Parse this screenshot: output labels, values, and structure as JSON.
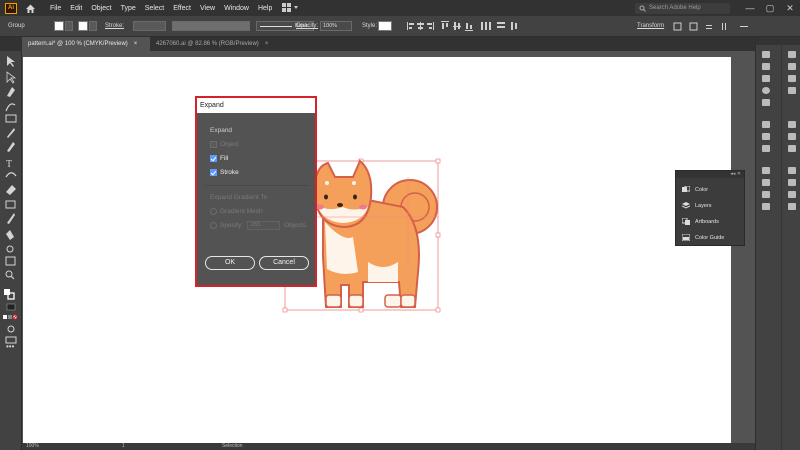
{
  "app": {
    "logo": "Ai"
  },
  "menu": [
    "File",
    "Edit",
    "Object",
    "Type",
    "Select",
    "Effect",
    "View",
    "Window",
    "Help"
  ],
  "search": {
    "placeholder": "Search Adobe Help"
  },
  "window_controls": {
    "minimize": "—",
    "maximize": "▢",
    "close": "✕"
  },
  "control_bar": {
    "selection_label": "Group",
    "stroke_label": "Stroke:",
    "brush_label": "Basic",
    "opacity_label": "Opacity:",
    "opacity_value": "100%",
    "style_label": "Style:",
    "transform_label": "Transform"
  },
  "tabs": [
    {
      "label": "pattern.ai* @ 100 % (CMYK/Preview)",
      "close": "×"
    },
    {
      "label": "4267060.ai @ 82.86 % (RGB/Preview)",
      "close": "×"
    }
  ],
  "float_panel": {
    "items": [
      {
        "label": "Color",
        "icon": "color-icon"
      },
      {
        "label": "Layers",
        "icon": "layers-icon"
      },
      {
        "label": "Artboards",
        "icon": "artboards-icon"
      },
      {
        "label": "Color Guide",
        "icon": "color-guide-icon"
      }
    ]
  },
  "dialog": {
    "title": "Expand",
    "expand_section": "Expand",
    "object_label": "Object",
    "fill_label": "Fill",
    "stroke_label": "Stroke",
    "gradient_section": "Expand Gradient To",
    "gradient_mesh_label": "Gradient Mesh",
    "specify_label": "Specify:",
    "specify_value": "255",
    "objects_label": "Objects",
    "ok": "OK",
    "cancel": "Cancel",
    "object_checked": false,
    "fill_checked": true,
    "stroke_checked": true
  },
  "status": {
    "zoom": "100%",
    "page": "1",
    "tool": "Selection"
  },
  "colors": {
    "highlight": "#d4222b",
    "checkbox": "#5b9bff",
    "shiba_orange": "#f5a05a",
    "selection_guides": "#f08080"
  }
}
